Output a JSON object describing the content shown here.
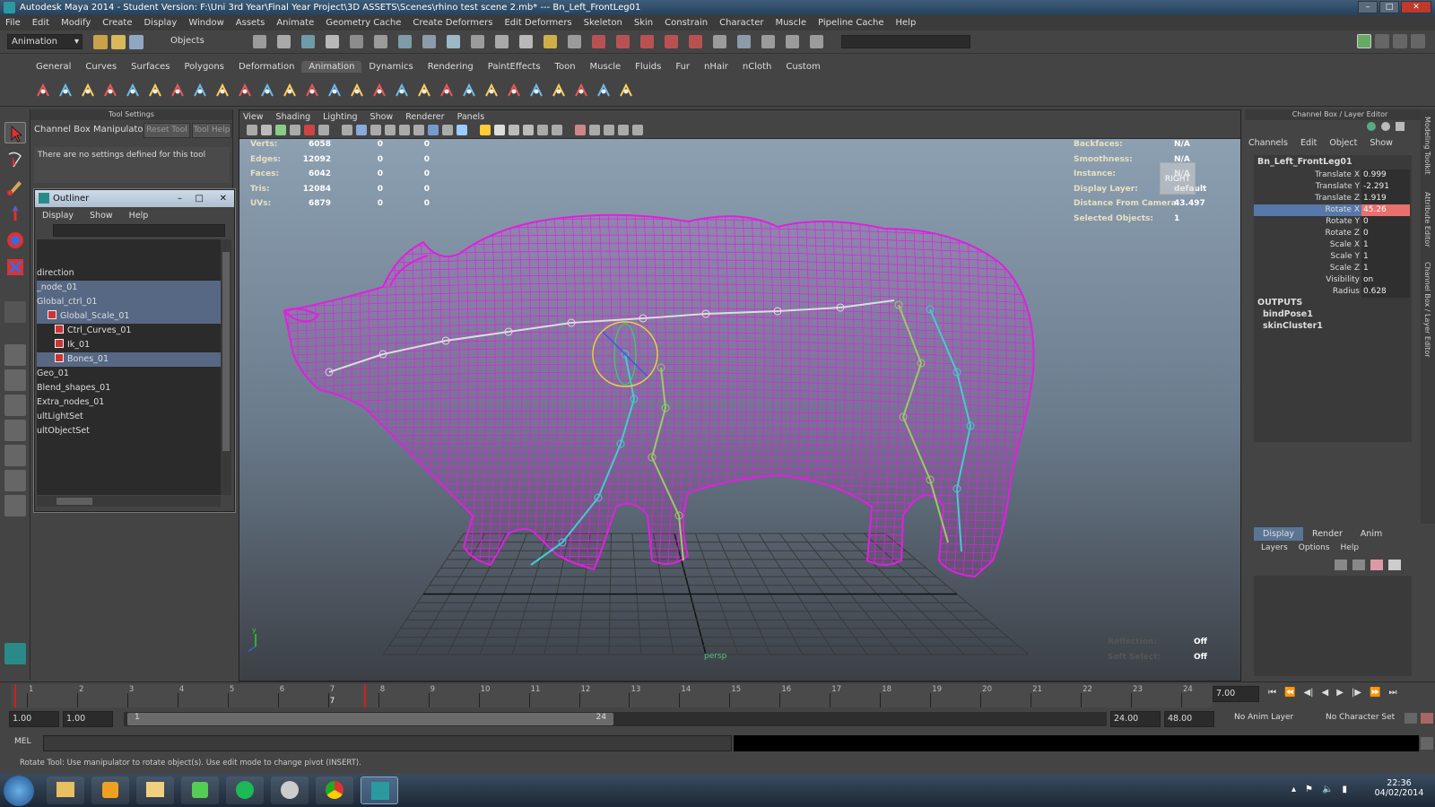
{
  "window": {
    "title": "Autodesk Maya 2014 - Student Version: F:\\Uni 3rd Year\\Final Year Project\\3D ASSETS\\Scenes\\rhino test scene 2.mb*   ---   Bn_Left_FrontLeg01"
  },
  "menubar": [
    "File",
    "Edit",
    "Modify",
    "Create",
    "Display",
    "Window",
    "Assets",
    "Animate",
    "Geometry Cache",
    "Create Deformers",
    "Edit Deformers",
    "Skeleton",
    "Skin",
    "Constrain",
    "Character",
    "Muscle",
    "Pipeline Cache",
    "Help"
  ],
  "status": {
    "menuset": "Animation",
    "selection_mode": "Objects"
  },
  "shelf_tabs": [
    "General",
    "Curves",
    "Surfaces",
    "Polygons",
    "Deformation",
    "Animation",
    "Dynamics",
    "Rendering",
    "PaintEffects",
    "Toon",
    "Muscle",
    "Fluids",
    "Fur",
    "nHair",
    "nCloth",
    "Custom"
  ],
  "shelf_active": "Animation",
  "tool_settings": {
    "header": "Tool Settings",
    "tool_name": "Channel Box Manipulator",
    "reset_label": "Reset Tool",
    "help_label": "Tool Help",
    "message": "There are no settings defined for this tool"
  },
  "outliner": {
    "title": "Outliner",
    "menus": [
      "Display",
      "Show",
      "Help"
    ],
    "items": [
      {
        "label": "direction",
        "selected": false,
        "indent": 0,
        "icon": false
      },
      {
        "label": "_node_01",
        "selected": true,
        "indent": 0,
        "icon": false
      },
      {
        "label": "Global_ctrl_01",
        "selected": true,
        "indent": 0,
        "icon": false
      },
      {
        "label": "Global_Scale_01",
        "selected": true,
        "indent": 1,
        "icon": true
      },
      {
        "label": "Ctrl_Curves_01",
        "selected": false,
        "indent": 2,
        "icon": true
      },
      {
        "label": "Ik_01",
        "selected": false,
        "indent": 2,
        "icon": true
      },
      {
        "label": "Bones_01",
        "selected": true,
        "indent": 2,
        "icon": true
      },
      {
        "label": "Geo_01",
        "selected": false,
        "indent": 0,
        "icon": false
      },
      {
        "label": "Blend_shapes_01",
        "selected": false,
        "indent": 0,
        "icon": false
      },
      {
        "label": "Extra_nodes_01",
        "selected": false,
        "indent": 0,
        "icon": false
      },
      {
        "label": "ultLightSet",
        "selected": false,
        "indent": 0,
        "icon": false
      },
      {
        "label": "ultObjectSet",
        "selected": false,
        "indent": 0,
        "icon": false
      }
    ]
  },
  "viewport": {
    "menus": [
      "View",
      "Shading",
      "Lighting",
      "Show",
      "Renderer",
      "Panels"
    ],
    "hud_left": [
      {
        "label": "Verts:",
        "a": "6058",
        "b": "0",
        "c": "0"
      },
      {
        "label": "Edges:",
        "a": "12092",
        "b": "0",
        "c": "0"
      },
      {
        "label": "Faces:",
        "a": "6042",
        "b": "0",
        "c": "0"
      },
      {
        "label": "Tris:",
        "a": "12084",
        "b": "0",
        "c": "0"
      },
      {
        "label": "UVs:",
        "a": "6879",
        "b": "0",
        "c": "0"
      }
    ],
    "hud_right": [
      {
        "label": "Backfaces:",
        "value": "N/A"
      },
      {
        "label": "Smoothness:",
        "value": "N/A"
      },
      {
        "label": "Instance:",
        "value": "N/A"
      },
      {
        "label": "Display Layer:",
        "value": "default"
      },
      {
        "label": "Distance From Camera:",
        "value": "43.497"
      },
      {
        "label": "Selected Objects:",
        "value": "1"
      }
    ],
    "viewcube_label": "RIGHT",
    "camera": "persp",
    "reflection_label": "Reflection:",
    "reflection_value": "Off",
    "softselect_label": "Soft Select:",
    "softselect_value": "Off",
    "wire_color": "#e020e0"
  },
  "channel_box": {
    "header": "Channel Box / Layer Editor",
    "menus": [
      "Channels",
      "Edit",
      "Object",
      "Show"
    ],
    "object": "Bn_Left_FrontLeg01",
    "channels": [
      {
        "name": "Translate X",
        "value": "0.999"
      },
      {
        "name": "Translate Y",
        "value": "-2.291"
      },
      {
        "name": "Translate Z",
        "value": "1.919"
      },
      {
        "name": "Rotate X",
        "value": "45.26",
        "selected": true
      },
      {
        "name": "Rotate Y",
        "value": "0"
      },
      {
        "name": "Rotate Z",
        "value": "0"
      },
      {
        "name": "Scale X",
        "value": "1"
      },
      {
        "name": "Scale Y",
        "value": "1"
      },
      {
        "name": "Scale Z",
        "value": "1"
      },
      {
        "name": "Visibility",
        "value": "on"
      },
      {
        "name": "Radius",
        "value": "0.628"
      }
    ],
    "outputs_label": "OUTPUTS",
    "outputs": [
      "bindPose1",
      "skinCluster1"
    ]
  },
  "side_tabs": [
    "Modeling Toolkit",
    "Attribute Editor",
    "Channel Box / Layer Editor"
  ],
  "layer_editor": {
    "tabs": [
      "Display",
      "Render",
      "Anim"
    ],
    "menus": [
      "Layers",
      "Options",
      "Help"
    ]
  },
  "timeline": {
    "ticks": [
      "1",
      "2",
      "3",
      "4",
      "5",
      "6",
      "7",
      "8",
      "9",
      "10",
      "11",
      "12",
      "13",
      "14",
      "15",
      "16",
      "17",
      "18",
      "19",
      "20",
      "21",
      "22",
      "23",
      "24"
    ],
    "current_frame": "7",
    "current_time": "7.00"
  },
  "range": {
    "start": "1.00",
    "start_inner": "1.00",
    "range_start_label": "1",
    "range_end_label": "24",
    "end": "24.00",
    "end_outer": "48.00",
    "anim_layer": "No Anim Layer",
    "character_set": "No Character Set"
  },
  "command": {
    "label": "MEL"
  },
  "helpline": "Rotate Tool: Use manipulator to rotate object(s). Use edit mode to change pivot (INSERT).",
  "taskbar": {
    "time": "22:36",
    "date": "04/02/2014"
  }
}
